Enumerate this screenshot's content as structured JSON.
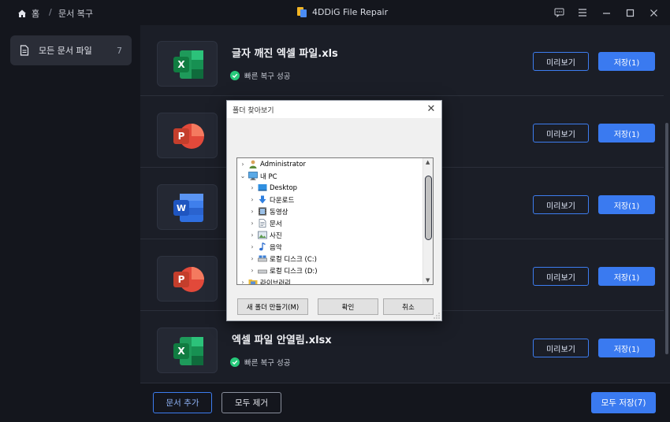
{
  "titlebar": {
    "home_label": "홈",
    "crumb_separator": "/",
    "crumb": "문서 복구",
    "app_title": "4DDiG File Repair"
  },
  "sidebar": {
    "items": [
      {
        "label": "모든 문서 파일",
        "count": "7"
      }
    ]
  },
  "files": [
    {
      "type": "excel",
      "name": "글자 깨진 엑셀 파일.xls",
      "status": "빠른 복구 성공",
      "preview": "미리보기",
      "save": "저장(1)"
    },
    {
      "type": "powerpoint",
      "name": "",
      "status": "",
      "preview": "미리보기",
      "save": "저장(1)"
    },
    {
      "type": "word",
      "name": "",
      "status": "",
      "preview": "미리보기",
      "save": "저장(1)"
    },
    {
      "type": "powerpoint",
      "name": "",
      "status": "",
      "preview": "미리보기",
      "save": "저장(1)"
    },
    {
      "type": "excel",
      "name": "엑셀 파일 안열림.xlsx",
      "status": "빠른 복구 성공",
      "preview": "미리보기",
      "save": "저장(1)"
    }
  ],
  "bottombar": {
    "add_label": "문서 추가",
    "clear_label": "모두 제거",
    "save_all_label": "모두 저장(7)"
  },
  "dialog": {
    "title": "폴더 찾아보기",
    "tree": [
      {
        "label": "Administrator",
        "icon": "user-icon",
        "expander": "›",
        "level": 0
      },
      {
        "label": "내 PC",
        "icon": "computer-icon",
        "expander": "⌄",
        "level": 0
      },
      {
        "label": "Desktop",
        "icon": "desktop-icon",
        "expander": "›",
        "level": 1
      },
      {
        "label": "다운로드",
        "icon": "download-icon",
        "expander": "›",
        "level": 1
      },
      {
        "label": "동영상",
        "icon": "video-icon",
        "expander": "›",
        "level": 1
      },
      {
        "label": "문서",
        "icon": "document-icon",
        "expander": "›",
        "level": 1
      },
      {
        "label": "사진",
        "icon": "picture-icon",
        "expander": "›",
        "level": 1
      },
      {
        "label": "음악",
        "icon": "music-icon",
        "expander": "›",
        "level": 1
      },
      {
        "label": "로컬 디스크 (C:)",
        "icon": "drive-icon",
        "expander": "›",
        "level": 1
      },
      {
        "label": "로컬 디스크 (D:)",
        "icon": "drive-icon",
        "expander": "›",
        "level": 1
      },
      {
        "label": "라이브러리",
        "icon": "library-icon",
        "expander": "›",
        "level": 0
      }
    ],
    "new_folder_label": "새 폴더 만들기(M)",
    "ok_label": "확인",
    "cancel_label": "취소"
  },
  "colors": {
    "accent": "#3a7af0",
    "success": "#27c97a",
    "excel": "#1e9a5a",
    "word": "#2f6fe0",
    "powerpoint": "#e2493a"
  }
}
